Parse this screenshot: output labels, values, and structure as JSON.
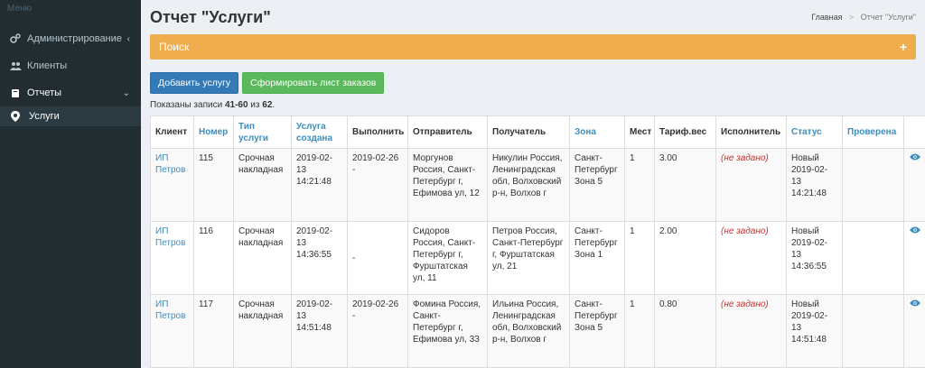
{
  "sidebar": {
    "header": "Меню",
    "items": [
      {
        "label": "Администрирование"
      },
      {
        "label": "Клиенты"
      },
      {
        "label": "Отчеты"
      }
    ],
    "subitem": {
      "label": "Услуги"
    }
  },
  "header": {
    "title": "Отчет \"Услуги\"",
    "breadcrumb_home": "Главная",
    "breadcrumb_sep": ">",
    "breadcrumb_current": "Отчет \"Услуги\""
  },
  "search": {
    "label": "Поиск",
    "toggle": "+"
  },
  "actions": {
    "add_label": "Добавить услугу",
    "form_label": "Сформировать лист заказов"
  },
  "summary": {
    "prefix": "Показаны записи ",
    "range": "41-60",
    "mid": " из ",
    "total": "62",
    "suffix": "."
  },
  "table": {
    "headers": [
      "Клиент",
      "Номер",
      "Тип услуги",
      "Услуга создана",
      "Выполнить",
      "Отправитель",
      "Получатель",
      "Зона",
      "Мест",
      "Тариф.вес",
      "Исполнитель",
      "Статус",
      "Проверена"
    ],
    "rows": [
      {
        "client": "ИП Петров",
        "number": "115",
        "type": "Срочная накладная",
        "created": "2019-02-13 14:21:48",
        "execute": "2019-02-26 -",
        "sender": "Моргунов Россия, Санкт-Петербург г, Ефимова ул, 12",
        "recipient": "Никулин Россия, Ленинградская обл, Волховский р-н, Волхов г",
        "zone": "Санкт-Петербург Зона 5",
        "places": "1",
        "weight": "3.00",
        "executor": "(не задано)",
        "status": "Новый 2019-02-13 14:21:48",
        "checked": ""
      },
      {
        "client": "ИП Петров",
        "number": "116",
        "type": "Срочная накладная",
        "created": "2019-02-13 14:36:55",
        "execute": "-",
        "sender": "Сидоров Россия, Санкт-Петербург г, Фурштатская ул, 11",
        "recipient": "Петров Россия, Санкт-Петербург г, Фурштатская ул, 21",
        "zone": "Санкт-Петербург Зона 1",
        "places": "1",
        "weight": "2.00",
        "executor": "(не задано)",
        "status": "Новый 2019-02-13 14:36:55",
        "checked": ""
      },
      {
        "client": "ИП Петров",
        "number": "117",
        "type": "Срочная накладная",
        "created": "2019-02-13 14:51:48",
        "execute": "2019-02-26 -",
        "sender": "Фомина Россия, Санкт-Петербург г, Ефимова ул, 33",
        "recipient": "Ильина Россия, Ленинградская обл, Волховский р-н, Волхов г",
        "zone": "Санкт-Петербург Зона 5",
        "places": "1",
        "weight": "0.80",
        "executor": "(не задано)",
        "status": "Новый 2019-02-13 14:51:48",
        "checked": ""
      }
    ]
  }
}
